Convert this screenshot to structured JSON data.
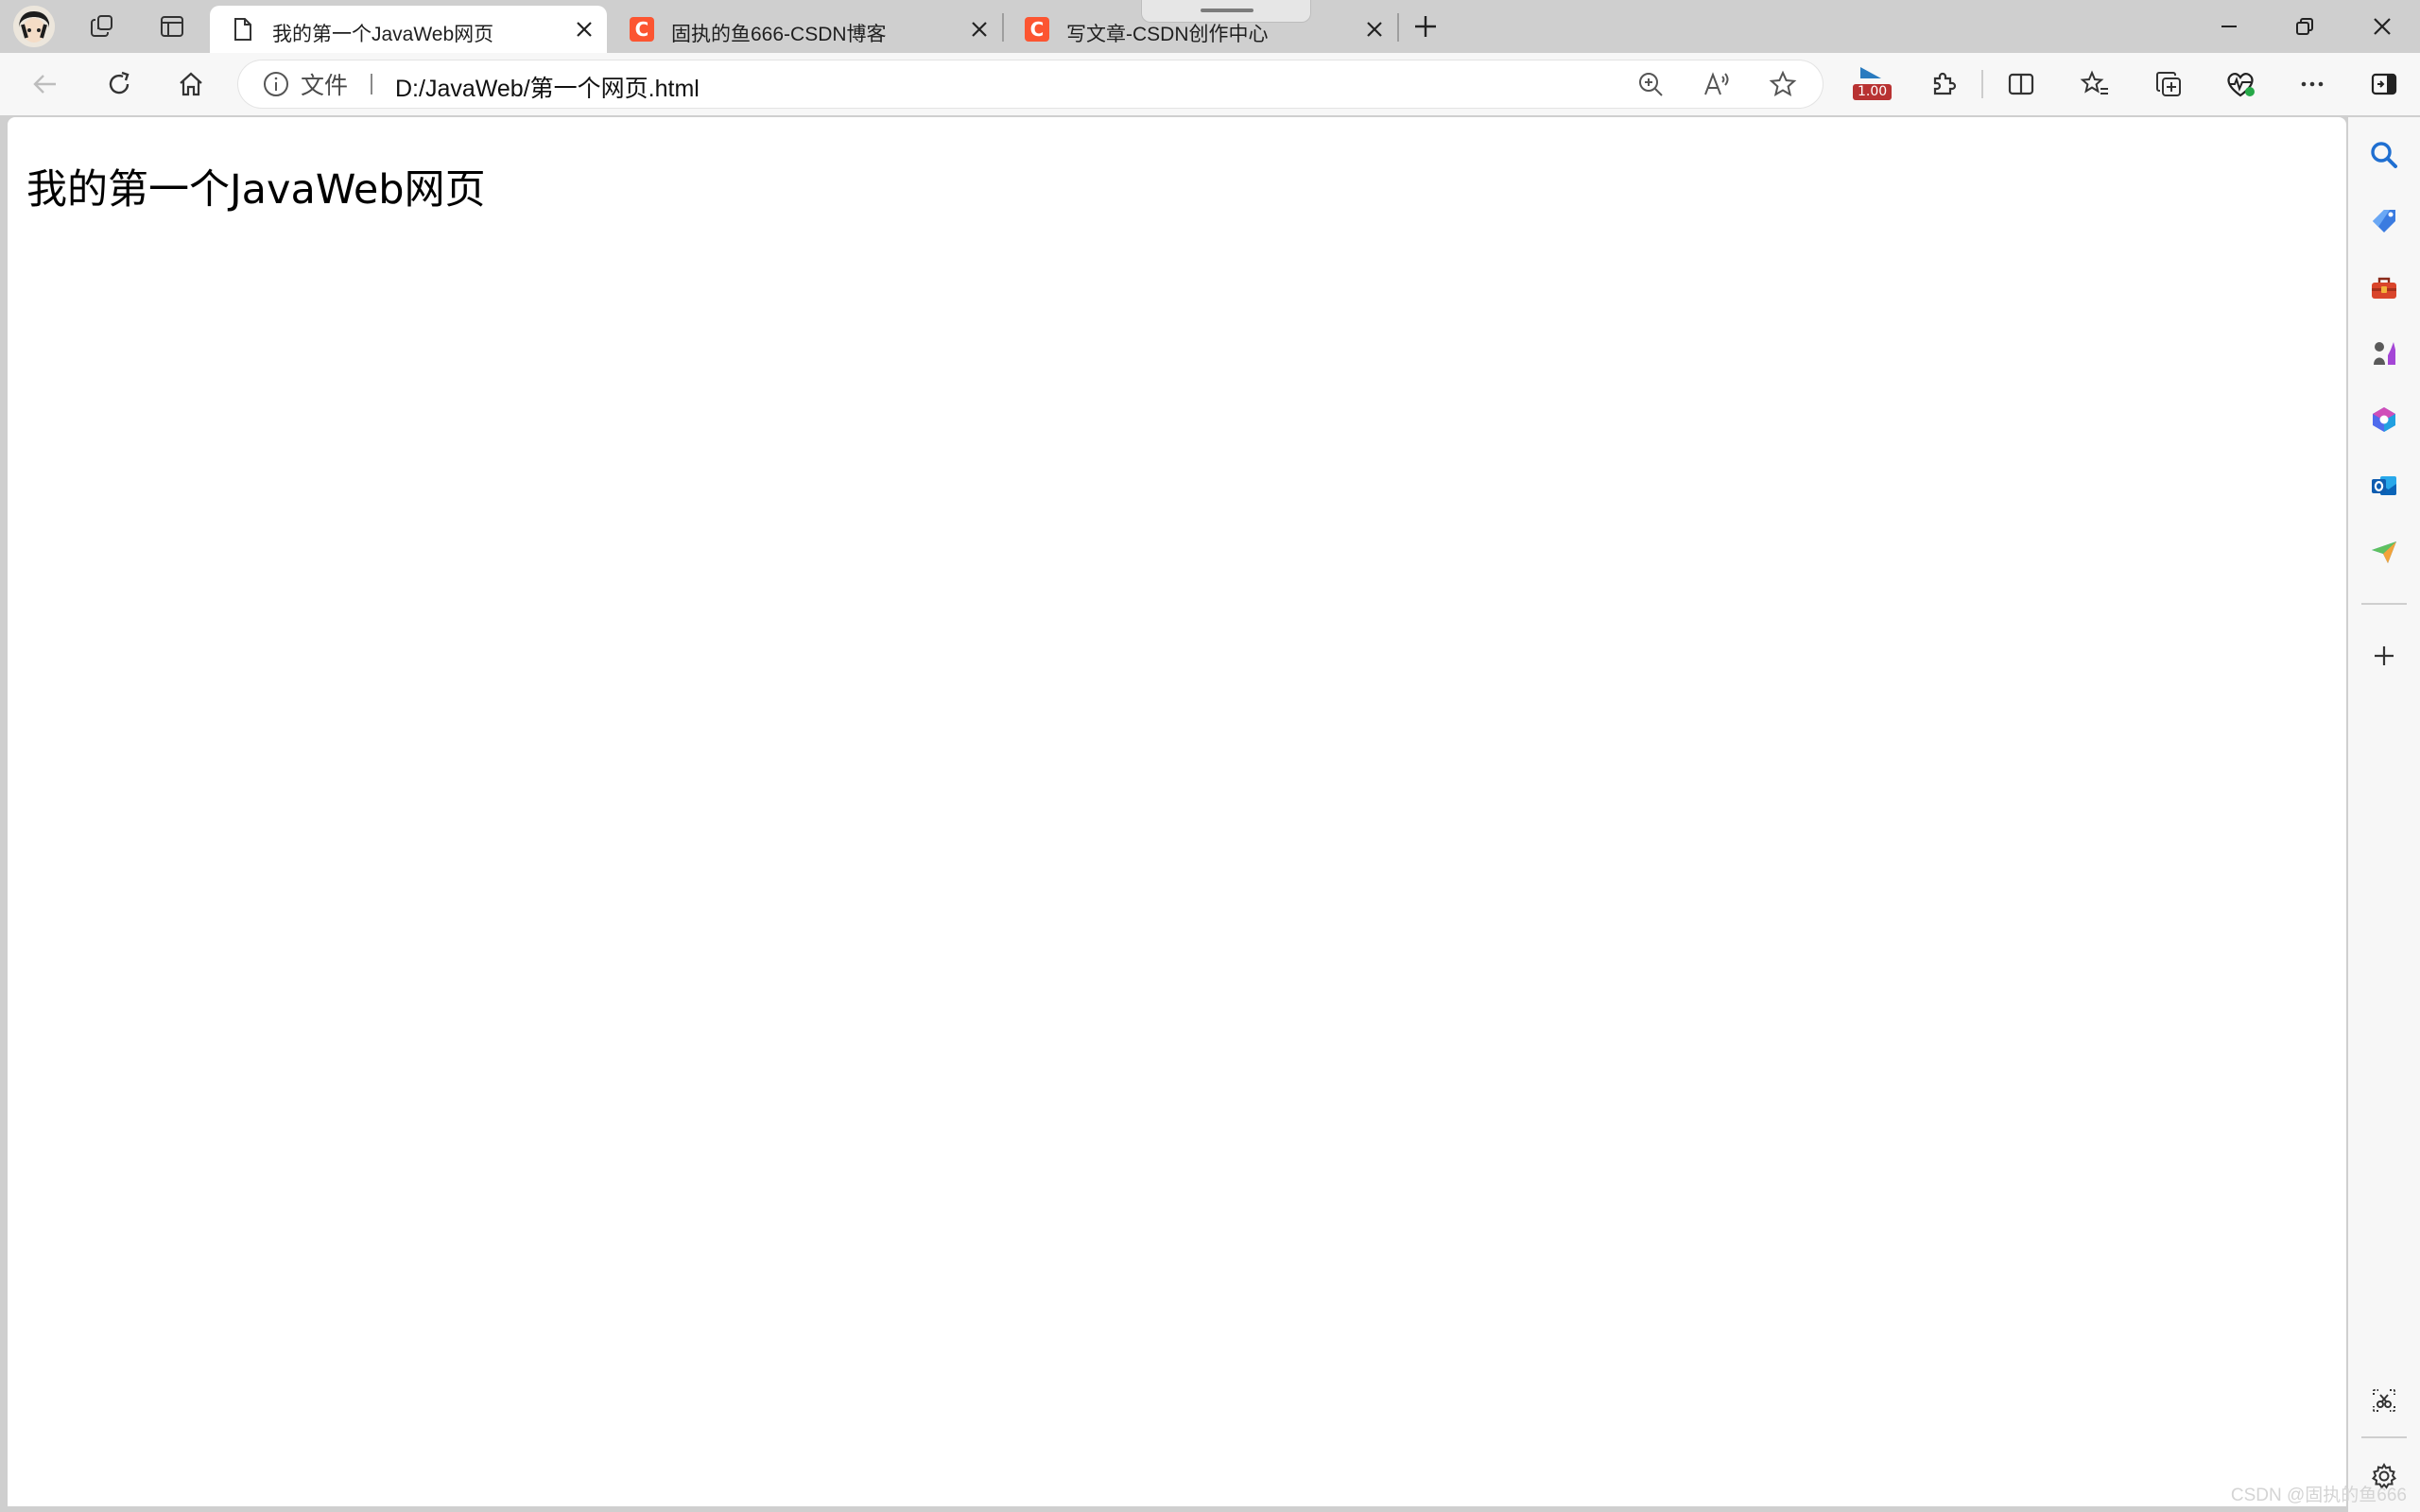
{
  "window": {
    "tabs": [
      {
        "title": "我的第一个JavaWeb网页",
        "active": true,
        "favicon": "file-icon"
      },
      {
        "title": "固执的鱼666-CSDN博客",
        "active": false,
        "favicon": "csdn-icon",
        "favicon_text": "C"
      },
      {
        "title": "写文章-CSDN创作中心",
        "active": false,
        "favicon": "csdn-icon",
        "favicon_text": "C"
      }
    ]
  },
  "toolbar": {
    "site_info_label": "文件",
    "url": "D:/JavaWeb/第一个网页.html",
    "extension_badge": "1.00"
  },
  "page": {
    "heading": "我的第一个JavaWeb网页"
  },
  "watermark": "CSDN @固执的鱼666",
  "colors": {
    "csdn_brand": "#fc5531",
    "badge": "#b83232",
    "tab_strip": "#cfcfcf",
    "toolbar": "#f7f7f7"
  }
}
